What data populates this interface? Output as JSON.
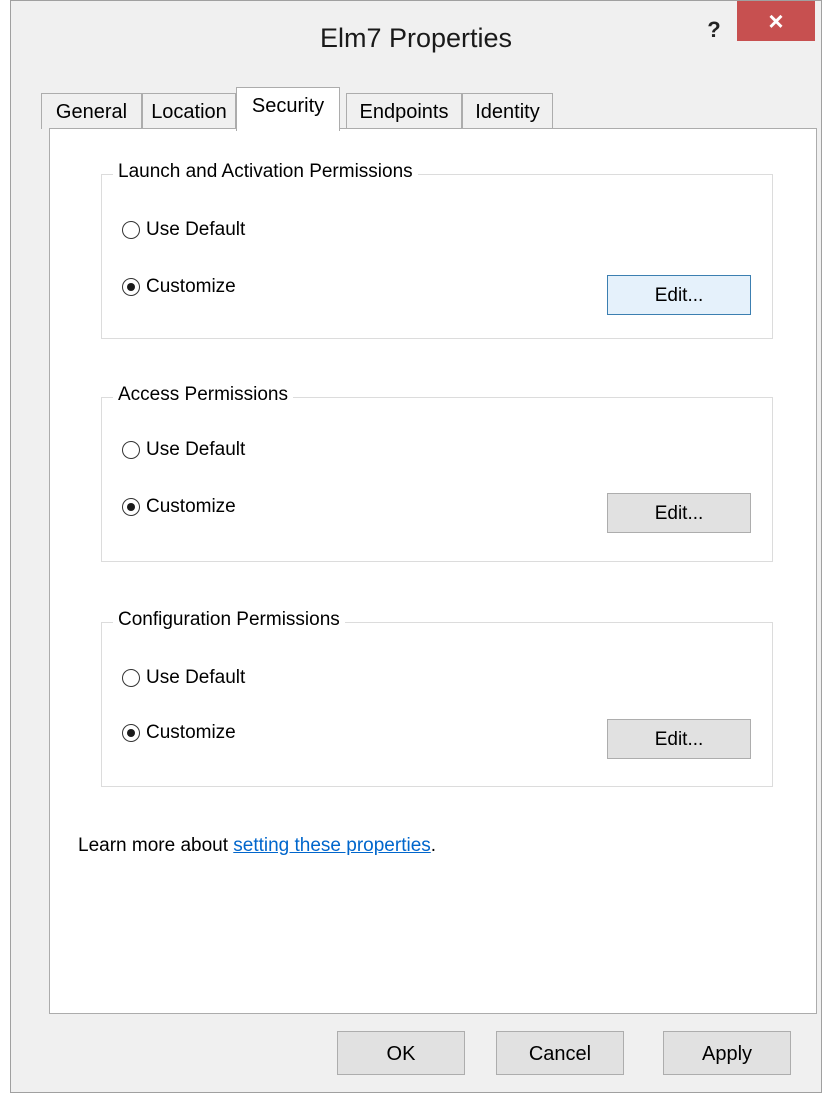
{
  "window": {
    "title": "Elm7 Properties",
    "help_label": "?",
    "close_label": "×"
  },
  "tabs": [
    {
      "label": "General"
    },
    {
      "label": "Location"
    },
    {
      "label": "Security",
      "active": true
    },
    {
      "label": "Endpoints"
    },
    {
      "label": "Identity"
    }
  ],
  "groups": {
    "launch": {
      "title": "Launch and Activation Permissions",
      "option_default": "Use Default",
      "option_custom": "Customize",
      "selected": "Customize",
      "edit_label": "Edit..."
    },
    "access": {
      "title": "Access Permissions",
      "option_default": "Use Default",
      "option_custom": "Customize",
      "selected": "Customize",
      "edit_label": "Edit..."
    },
    "config": {
      "title": "Configuration Permissions",
      "option_default": "Use Default",
      "option_custom": "Customize",
      "selected": "Customize",
      "edit_label": "Edit..."
    }
  },
  "learn": {
    "prefix": "Learn more about ",
    "link": "setting these properties",
    "suffix": "."
  },
  "footer": {
    "ok_label": "OK",
    "cancel_label": "Cancel",
    "apply_label": "Apply"
  },
  "colors": {
    "close_button": "#c75050",
    "link": "#0066cc",
    "focus_border": "#3c7fb1"
  }
}
